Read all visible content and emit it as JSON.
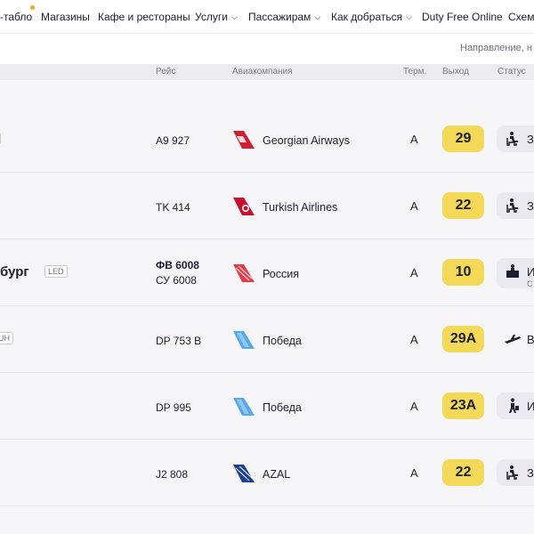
{
  "nav": {
    "items": [
      {
        "label": "-табло"
      },
      {
        "label": "Магазины"
      },
      {
        "label": "Кафе и рестораны"
      },
      {
        "label": "Услуги",
        "chevron": true
      },
      {
        "label": "Пассажирам",
        "chevron": true
      },
      {
        "label": "Как добраться",
        "chevron": true
      },
      {
        "label": "Duty Free Online"
      },
      {
        "label": "Схема"
      }
    ]
  },
  "search": {
    "placeholder": "Направление, н"
  },
  "table": {
    "headers": {
      "flight": "Рейс",
      "airline": "Авиакомпания",
      "terminal": "Терм.",
      "gate": "Выход",
      "status": "Статус"
    }
  },
  "rows": [
    {
      "city": "",
      "code": "",
      "flights": [
        "A9 927"
      ],
      "airline": "Georgian Airways",
      "logo": "georgian-airways-logo",
      "terminal": "A",
      "gate": "29",
      "status": {
        "icon": "waiting-seat-icon",
        "text": "З",
        "sub": ""
      }
    },
    {
      "city": "",
      "code": "",
      "flights": [
        "TK 414"
      ],
      "airline": "Turkish Airlines",
      "logo": "turkish-airlines-logo",
      "terminal": "A",
      "gate": "22",
      "status": {
        "icon": "waiting-seat-icon",
        "text": "З",
        "sub": ""
      }
    },
    {
      "city": "бург",
      "code": "LED",
      "flights": [
        "ФВ 6008",
        "СУ 6008"
      ],
      "airline": "Россия",
      "logo": "rossiya-logo",
      "terminal": "A",
      "gate": "10",
      "status": {
        "icon": "checkin-desk-icon",
        "text": "И",
        "sub": "С"
      }
    },
    {
      "city": "",
      "code": "UH",
      "flights": [
        "DP 753 B"
      ],
      "airline": "Победа",
      "logo": "pobeda-logo",
      "terminal": "A",
      "gate": "29A",
      "status": {
        "icon": "departed-plane-icon",
        "text": "В",
        "sub": ""
      }
    },
    {
      "city": "",
      "code": "",
      "flights": [
        "DP 995"
      ],
      "airline": "Победа",
      "logo": "pobeda-logo",
      "terminal": "A",
      "gate": "23A",
      "status": {
        "icon": "walking-passenger-icon",
        "text": "И",
        "sub": ""
      }
    },
    {
      "city": "",
      "code": "",
      "flights": [
        "J2 808"
      ],
      "airline": "AZAL",
      "logo": "azal-logo",
      "terminal": "A",
      "gate": "22",
      "status": {
        "icon": "waiting-seat-icon",
        "text": "З",
        "sub": ""
      }
    }
  ],
  "colors": {
    "gate_badge": "#f4d857",
    "status_box": "#e9e9ef",
    "nav_dot": "#f0a81c"
  }
}
